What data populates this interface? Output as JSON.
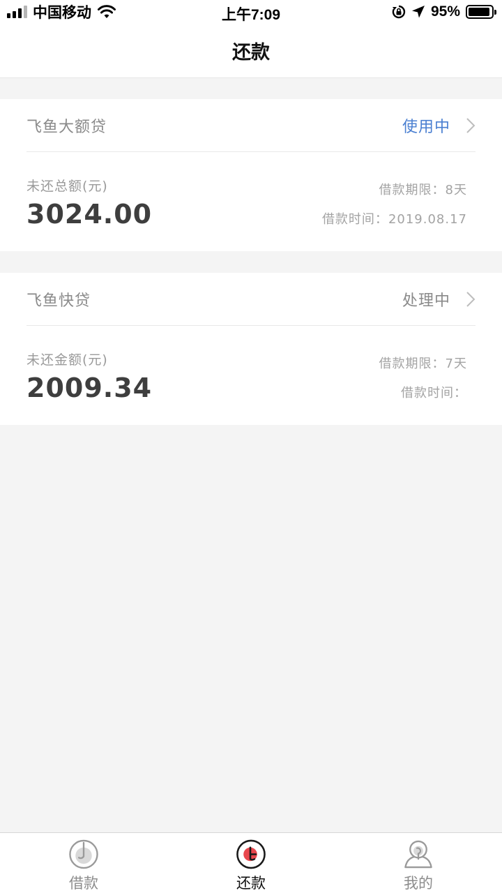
{
  "status_bar": {
    "carrier": "中国移动",
    "time": "上午7:09",
    "battery": "95%",
    "battery_level": 0.95
  },
  "header": {
    "title": "还款"
  },
  "loans": [
    {
      "name": "飞鱼大额贷",
      "status": "使用中",
      "status_color": "#4a7fd1",
      "amount_label": "未还总额(元)",
      "amount": "3024.00",
      "term_label": "借款期限：",
      "term_value": "8天",
      "date_label": "借款时间：",
      "date_value": "2019.08.17"
    },
    {
      "name": "飞鱼快贷",
      "status": "处理中",
      "status_color": "#8a8a8a",
      "amount_label": "未还金额(元)",
      "amount": "2009.34",
      "term_label": "借款期限：",
      "term_value": "7天",
      "date_label": "借款时间：",
      "date_value": ""
    }
  ],
  "tabs": [
    {
      "label": "借款",
      "icon": "borrow-icon",
      "active": false
    },
    {
      "label": "还款",
      "icon": "repay-icon",
      "active": true
    },
    {
      "label": "我的",
      "icon": "profile-icon",
      "active": false
    }
  ],
  "colors": {
    "accent_blue": "#4a7fd1",
    "accent_red": "#e8474d",
    "background": "#f4f4f4"
  }
}
